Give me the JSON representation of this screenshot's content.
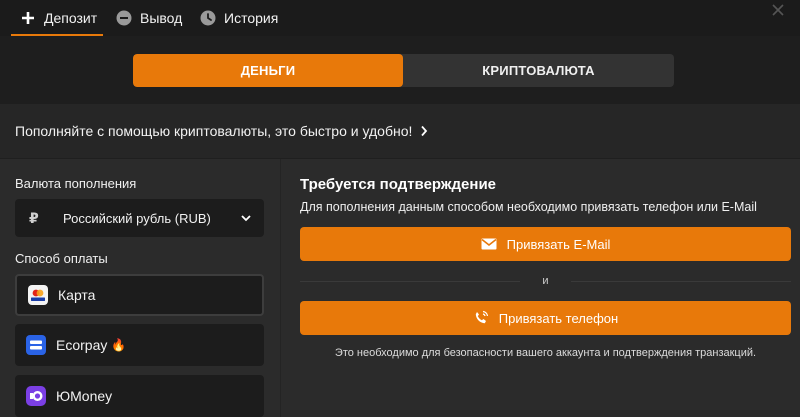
{
  "tabs": [
    {
      "label": "Депозит",
      "icon": "plus-icon",
      "active": true
    },
    {
      "label": "Вывод",
      "icon": "minus-circle-icon",
      "active": false
    },
    {
      "label": "История",
      "icon": "clock-icon",
      "active": false
    }
  ],
  "close_icon": "close-icon",
  "switcher": {
    "money_label": "ДЕНЬГИ",
    "crypto_label": "КРИПТОВАЛЮТА",
    "active": "money"
  },
  "banner": {
    "text": "Пополняйте с помощью криптовалюты, это быстро и удобно!",
    "icon": "chevron-right-icon"
  },
  "left": {
    "currency_label": "Валюта пополнения",
    "currency_symbol": "₽",
    "currency_value": "Российский рубль (RUB)",
    "method_label": "Способ оплаты",
    "methods": [
      {
        "label": "Карта",
        "icon": "visa-card-icon",
        "selected": true
      },
      {
        "label": "Ecorpay",
        "icon": "ecorpay-icon",
        "badge": "🔥",
        "selected": false
      },
      {
        "label": "ЮMoney",
        "icon": "yoomoney-icon",
        "selected": false
      }
    ]
  },
  "right": {
    "title": "Требуется подтверждение",
    "description": "Для пополнения данным способом необходимо привязать телефон или E-Mail",
    "email_button": "Привязать E-Mail",
    "or_text": "и",
    "phone_button": "Привязать телефон",
    "note": "Это необходимо для безопасности вашего аккаунта и подтверждения транзакций."
  },
  "colors": {
    "accent": "#e8790a",
    "bg": "#2b2b2b",
    "bar": "#1b1b1b",
    "field": "#1c1c1c"
  }
}
